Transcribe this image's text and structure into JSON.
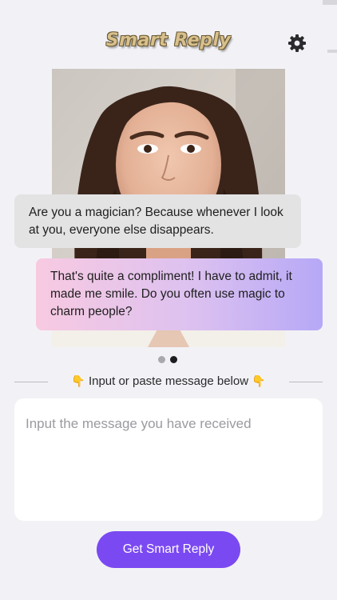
{
  "header": {
    "title": "Smart Reply",
    "settings_icon": "gear-icon"
  },
  "preview": {
    "received_message": "Are you a magician? Because whenever I look at you, everyone else disappears.",
    "sent_reply": "That's quite a compliment! I have to admit, it made me smile. Do you often use magic to charm people?",
    "carousel": {
      "total": 2,
      "active": 2
    }
  },
  "divider": {
    "left_emoji": "👇",
    "text": "Input or paste message below",
    "right_emoji": "👇"
  },
  "input": {
    "value": "",
    "placeholder": "Input the message you have received"
  },
  "action": {
    "label": "Get Smart Reply"
  },
  "colors": {
    "background": "#f2f2f6",
    "accent": "#7b49f2",
    "received_bubble": "#e3e3e4",
    "sent_bubble_gradient": [
      "#f8cae1",
      "#dcc1f0",
      "#b6a8f7"
    ]
  }
}
